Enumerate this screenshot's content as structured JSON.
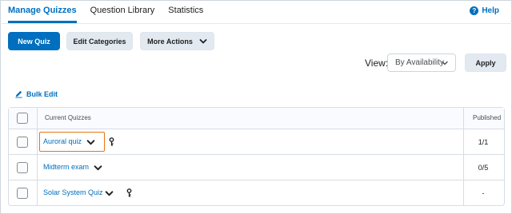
{
  "tabs": [
    {
      "label": "Manage Quizzes",
      "active": true
    },
    {
      "label": "Question Library",
      "active": false
    },
    {
      "label": "Statistics",
      "active": false
    }
  ],
  "help": {
    "label": "Help",
    "icon": "help-circle-icon"
  },
  "toolbar": {
    "new_quiz": "New Quiz",
    "edit_categories": "Edit Categories",
    "more_actions": "More Actions"
  },
  "view": {
    "label": "View:",
    "selected": "By Availability",
    "apply": "Apply"
  },
  "bulk_edit": {
    "label": "Bulk Edit",
    "icon": "pencil-icon"
  },
  "table": {
    "headers": {
      "current": "Current Quizzes",
      "published": "Published"
    },
    "rows": [
      {
        "name": "Auroral quiz",
        "has_key": true,
        "published": "1/1",
        "focused": true
      },
      {
        "name": "Midterm exam",
        "has_key": false,
        "published": "0/5",
        "focused": false
      },
      {
        "name": "Solar System Quiz",
        "has_key": true,
        "published": "-",
        "focused": false
      }
    ]
  },
  "colors": {
    "accent": "#006fbf",
    "focus_outline": "#e87511",
    "secondary_button": "#e3e9f1"
  }
}
